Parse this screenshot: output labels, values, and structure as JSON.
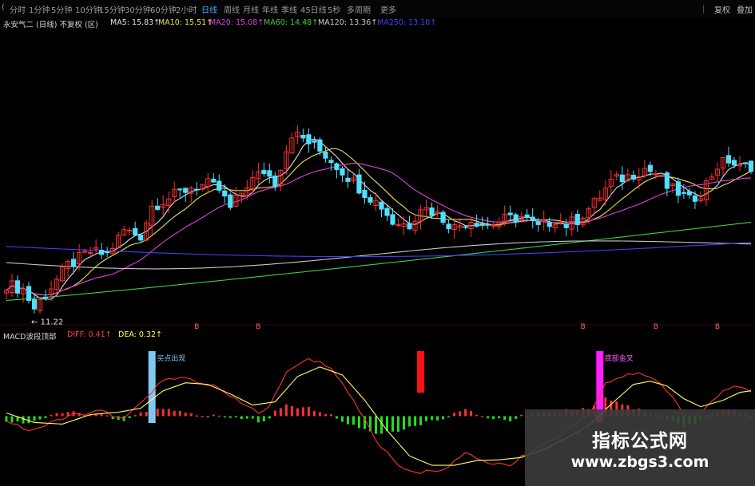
{
  "toolbar": {
    "tabs": [
      "(",
      "分时",
      "1分钟",
      "5分钟",
      "10分钟",
      "15分钟",
      "30分钟",
      "60分钟",
      "2小时",
      "日线",
      "周线",
      "月线",
      "年线",
      "季线",
      "45日线",
      "5秒",
      "多周期",
      "更多"
    ],
    "active_tab": "日线",
    "right_buttons": [
      "复权",
      "叠加"
    ]
  },
  "legend": {
    "title": "永安气二 (日线)  不复权  (区)",
    "items": [
      {
        "label": "MA5: 15.83↑",
        "color": "#e0e0e0"
      },
      {
        "label": "MA10: 15.51↑",
        "color": "#e8e060"
      },
      {
        "label": "MA20: 15.08↑",
        "color": "#e040e0"
      },
      {
        "label": "MA60: 14.48↑",
        "color": "#40d040"
      },
      {
        "label": "MA120: 13.36↑",
        "color": "#c8c8c8"
      },
      {
        "label": "MA250: 13.10↑",
        "color": "#4040ff"
      }
    ]
  },
  "macd_legend": {
    "title": "MACD波段顶部",
    "items": [
      {
        "label": "DIFF: 0.41↑",
        "color": "#ff4040"
      },
      {
        "label": "DEA: 0.32↑",
        "color": "#ffff60"
      }
    ]
  },
  "annotations": {
    "low_price": "← 11.22",
    "markers": [
      {
        "label": "B",
        "index": 34
      },
      {
        "label": "B",
        "index": 45
      },
      {
        "label": "B",
        "index": 103
      },
      {
        "label": "B",
        "index": 116
      },
      {
        "label": "B",
        "index": 127
      }
    ],
    "signals": [
      {
        "label": "买点出现",
        "index": 26,
        "color": "#80c8f0"
      },
      {
        "label": "",
        "index": 74,
        "color": "#ff1010"
      },
      {
        "label": "底部金叉",
        "index": 106,
        "color": "#ff20ff"
      }
    ]
  },
  "watermark": {
    "title": "指标公式网",
    "url": "www.zbgs3.com"
  },
  "chart_data": {
    "type": "candlestick",
    "x_count": 134,
    "price_keyframes": [
      [
        0,
        12.2
      ],
      [
        3,
        12.0
      ],
      [
        5,
        11.3
      ],
      [
        8,
        12.1
      ],
      [
        11,
        12.9
      ],
      [
        15,
        13.4
      ],
      [
        18,
        13.3
      ],
      [
        21,
        14.2
      ],
      [
        24,
        14.0
      ],
      [
        26,
        15.1
      ],
      [
        29,
        15.4
      ],
      [
        33,
        15.8
      ],
      [
        36,
        15.9
      ],
      [
        38,
        15.7
      ],
      [
        40,
        15.0
      ],
      [
        43,
        15.9
      ],
      [
        46,
        16.4
      ],
      [
        48,
        16.0
      ],
      [
        51,
        17.8
      ],
      [
        53,
        17.6
      ],
      [
        55,
        17.3
      ],
      [
        57,
        17.0
      ],
      [
        59,
        16.6
      ],
      [
        61,
        16.2
      ],
      [
        64,
        15.6
      ],
      [
        67,
        15.1
      ],
      [
        69,
        14.5
      ],
      [
        72,
        14.4
      ],
      [
        74,
        15.1
      ],
      [
        77,
        14.8
      ],
      [
        80,
        14.3
      ],
      [
        83,
        14.6
      ],
      [
        86,
        14.4
      ],
      [
        89,
        14.6
      ],
      [
        92,
        14.7
      ],
      [
        95,
        14.3
      ],
      [
        98,
        14.6
      ],
      [
        100,
        14.4
      ],
      [
        102,
        14.6
      ],
      [
        105,
        15.2
      ],
      [
        108,
        16.0
      ],
      [
        111,
        16.2
      ],
      [
        114,
        16.5
      ],
      [
        116,
        16.3
      ],
      [
        118,
        15.8
      ],
      [
        120,
        15.6
      ],
      [
        122,
        15.3
      ],
      [
        124,
        15.6
      ],
      [
        127,
        16.6
      ],
      [
        129,
        16.8
      ],
      [
        131,
        16.5
      ],
      [
        133,
        16.6
      ]
    ],
    "ma_periods": [
      5,
      10,
      20,
      60,
      120,
      250
    ],
    "macd": {
      "diff_keyframes": [
        [
          0,
          -0.05
        ],
        [
          4,
          -0.18
        ],
        [
          7,
          -0.12
        ],
        [
          12,
          0.02
        ],
        [
          17,
          0.06
        ],
        [
          21,
          -0.05
        ],
        [
          25,
          0.25
        ],
        [
          28,
          0.45
        ],
        [
          32,
          0.48
        ],
        [
          37,
          0.38
        ],
        [
          41,
          0.2
        ],
        [
          45,
          0.05
        ],
        [
          47,
          0.12
        ],
        [
          50,
          0.55
        ],
        [
          54,
          0.72
        ],
        [
          58,
          0.62
        ],
        [
          62,
          0.2
        ],
        [
          66,
          -0.3
        ],
        [
          70,
          -0.62
        ],
        [
          74,
          -0.72
        ],
        [
          78,
          -0.66
        ],
        [
          82,
          -0.48
        ],
        [
          86,
          -0.58
        ],
        [
          90,
          -0.62
        ],
        [
          94,
          -0.42
        ],
        [
          98,
          -0.28
        ],
        [
          101,
          -0.12
        ],
        [
          104,
          0.02
        ],
        [
          107,
          0.42
        ],
        [
          110,
          0.5
        ],
        [
          113,
          0.56
        ],
        [
          116,
          0.46
        ],
        [
          119,
          0.25
        ],
        [
          121,
          0.0
        ],
        [
          124,
          0.05
        ],
        [
          128,
          0.32
        ],
        [
          131,
          0.38
        ],
        [
          133,
          0.3
        ]
      ],
      "dea_keyframes": [
        [
          0,
          0.04
        ],
        [
          5,
          -0.08
        ],
        [
          10,
          -0.1
        ],
        [
          15,
          0.02
        ],
        [
          20,
          0.05
        ],
        [
          24,
          0.1
        ],
        [
          28,
          0.32
        ],
        [
          32,
          0.42
        ],
        [
          36,
          0.4
        ],
        [
          40,
          0.28
        ],
        [
          44,
          0.14
        ],
        [
          48,
          0.18
        ],
        [
          52,
          0.5
        ],
        [
          56,
          0.62
        ],
        [
          60,
          0.52
        ],
        [
          64,
          0.2
        ],
        [
          68,
          -0.18
        ],
        [
          72,
          -0.5
        ],
        [
          76,
          -0.62
        ],
        [
          80,
          -0.62
        ],
        [
          84,
          -0.56
        ],
        [
          88,
          -0.55
        ],
        [
          92,
          -0.52
        ],
        [
          96,
          -0.42
        ],
        [
          100,
          -0.28
        ],
        [
          104,
          -0.12
        ],
        [
          108,
          0.15
        ],
        [
          112,
          0.4
        ],
        [
          115,
          0.44
        ],
        [
          118,
          0.38
        ],
        [
          121,
          0.22
        ],
        [
          124,
          0.12
        ],
        [
          128,
          0.2
        ],
        [
          131,
          0.3
        ],
        [
          133,
          0.32
        ]
      ],
      "ylim": [
        -0.85,
        0.9
      ]
    },
    "price_ylim": [
      10.9,
      18.6
    ]
  }
}
